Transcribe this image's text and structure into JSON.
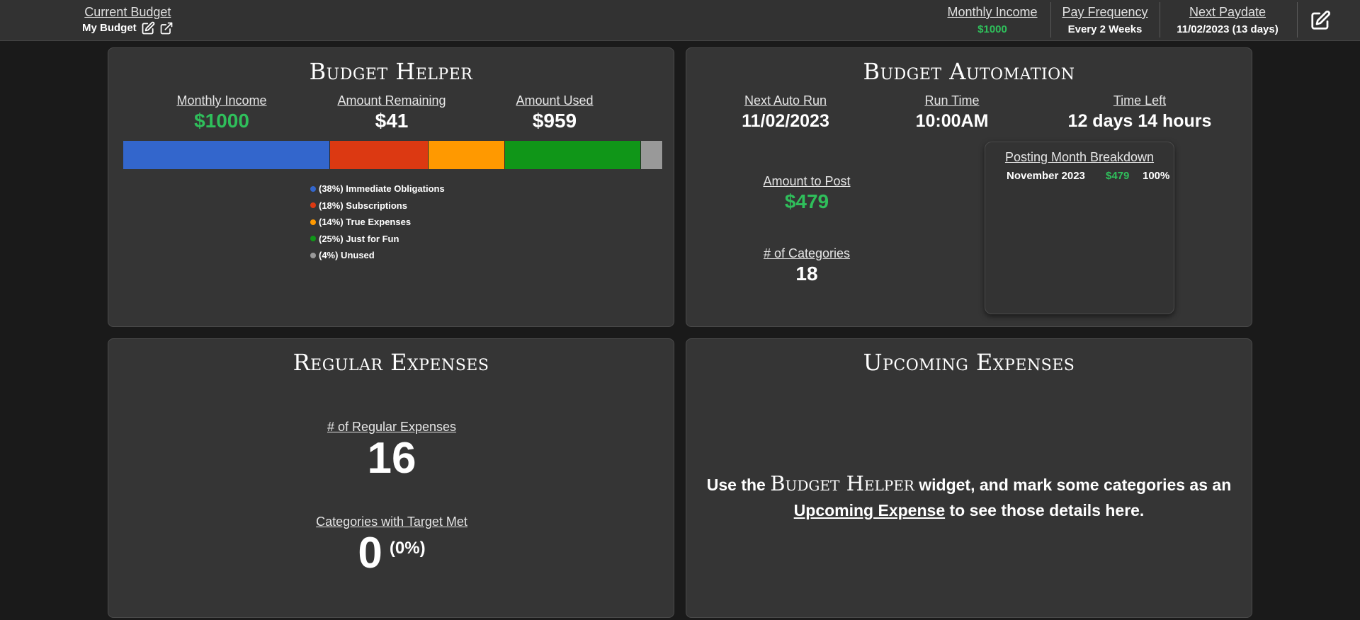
{
  "topbar": {
    "current_budget_label": "Current Budget",
    "current_budget_value": "My Budget",
    "monthly_income_label": "Monthly Income",
    "monthly_income_value": "$1000",
    "pay_frequency_label": "Pay Frequency",
    "pay_frequency_value": "Every 2 Weeks",
    "next_paydate_label": "Next Paydate",
    "next_paydate_value": "11/02/2023 (13 days)",
    "icons": [
      "edit-icon",
      "external-link-icon",
      "edit-icon"
    ]
  },
  "budget_helper": {
    "title": "Budget Helper",
    "monthly_income_label": "Monthly Income",
    "monthly_income_value": "$1000",
    "amount_remaining_label": "Amount Remaining",
    "amount_remaining_value": "$41",
    "amount_used_label": "Amount Used",
    "amount_used_value": "$959",
    "segments": [
      {
        "label": "(38%) Immediate Obligations",
        "percent": 38,
        "color": "#3366cc"
      },
      {
        "label": "(18%) Subscriptions",
        "percent": 18,
        "color": "#dc3912"
      },
      {
        "label": "(14%) True Expenses",
        "percent": 14,
        "color": "#ff9900"
      },
      {
        "label": "(25%) Just for Fun",
        "percent": 25,
        "color": "#109618"
      },
      {
        "label": "(4%) Unused",
        "percent": 4,
        "color": "#999999"
      }
    ]
  },
  "budget_automation": {
    "title": "Budget Automation",
    "next_auto_run_label": "Next Auto Run",
    "next_auto_run_value": "11/02/2023",
    "run_time_label": "Run Time",
    "run_time_value": "10:00AM",
    "time_left_label": "Time Left",
    "time_left_value": "12 days 14 hours",
    "amount_to_post_label": "Amount to Post",
    "amount_to_post_value": "$479",
    "categories_label": "# of Categories",
    "categories_value": "18",
    "posting_breakdown": {
      "title": "Posting Month Breakdown",
      "rows": [
        {
          "month": "November 2023",
          "amount": "$479",
          "percent": "100%"
        }
      ]
    }
  },
  "regular_expenses": {
    "title": "Regular Expenses",
    "count_label": "# of Regular Expenses",
    "count_value": "16",
    "target_met_label": "Categories with Target Met",
    "target_met_value": "0",
    "target_met_percent": "(0%)"
  },
  "upcoming_expenses": {
    "title": "Upcoming Expenses",
    "msg_prefix": "Use the",
    "msg_widget": "Budget Helper",
    "msg_middle": "widget, and mark some categories as an",
    "msg_link": "Upcoming Expense",
    "msg_suffix": "to see those details here."
  },
  "colors": {
    "income_green": "#2fbf5b",
    "card_bg": "#353535",
    "page_bg": "#1a1a1a",
    "topbar_bg": "#323232"
  }
}
